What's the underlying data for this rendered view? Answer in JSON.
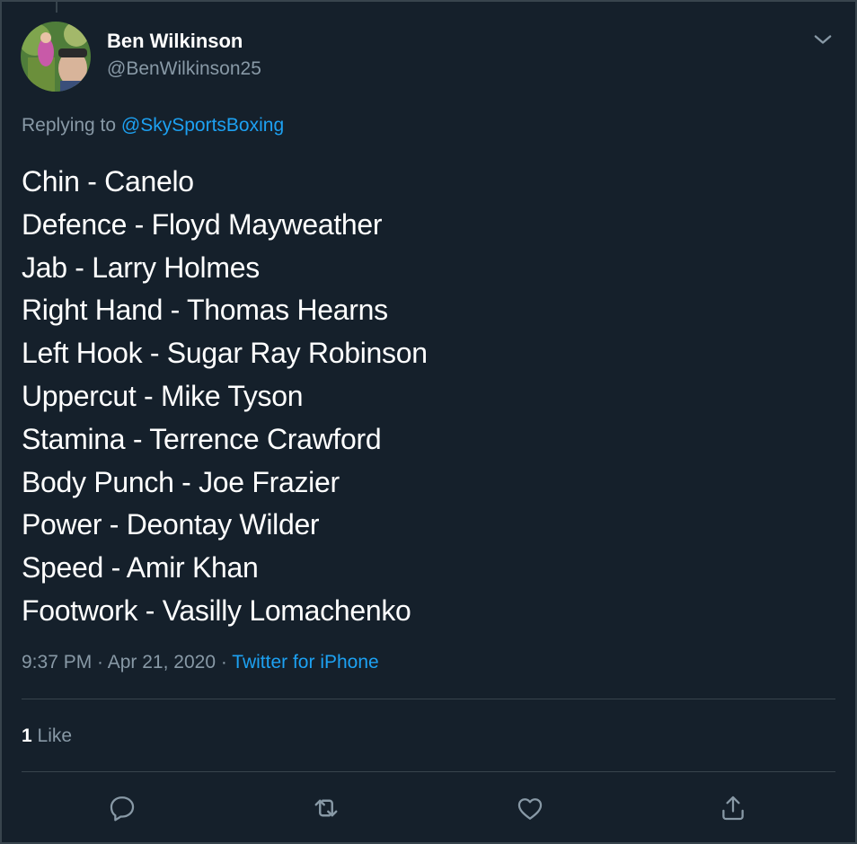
{
  "author": {
    "display_name": "Ben Wilkinson",
    "handle": "@BenWilkinson25",
    "avatar_icon": "user-avatar"
  },
  "reply": {
    "prefix": "Replying to ",
    "mention": "@SkySportsBoxing"
  },
  "tweet": {
    "lines": [
      "Chin - Canelo",
      "Defence - Floyd Mayweather",
      "Jab - Larry Holmes",
      "Right Hand - Thomas Hearns",
      "Left Hook - Sugar Ray Robinson",
      "Uppercut - Mike Tyson",
      "Stamina - Terrence Crawford",
      "Body Punch - Joe Frazier",
      "Power - Deontay Wilder",
      "Speed - Amir Khan",
      "Footwork - Vasilly Lomachenko"
    ]
  },
  "meta": {
    "time": "9:37 PM",
    "sep1": " · ",
    "date": "Apr 21, 2020",
    "sep2": " · ",
    "source": "Twitter for iPhone"
  },
  "stats": {
    "likes_count": "1",
    "likes_label": " Like"
  },
  "actions": {
    "icons": [
      "reply-icon",
      "retweet-icon",
      "like-icon",
      "share-icon"
    ]
  },
  "colors": {
    "background": "#15202b",
    "accent": "#1da1f2",
    "muted": "#8899a6",
    "divider": "#38444d"
  }
}
